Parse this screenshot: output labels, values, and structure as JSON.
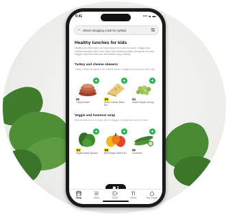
{
  "status": {
    "time": "9:41",
    "signal": "••• ▴ ▬"
  },
  "search": {
    "text": "What's shopping crush for mylistid"
  },
  "page": {
    "title": "Healthy lunches for kids",
    "description": "Healthy lunches make our kids enjoy not to eat the same. Veggie and cheese skewers offer a fun, fresh and nutritious option alongside an easy veggie wrap that kids love and adults enjoy making."
  },
  "sections": [
    {
      "title": "Turkey and cheese skewers",
      "subtitle": "Turkey cutlets are served with cheese pieces, veggies and crackers with a dip.",
      "products": [
        {
          "price": "$6",
          "name": "Turkey Breast",
          "sale": false,
          "image": "turkey-slices"
        },
        {
          "price": "$6",
          "name": "Swiss Cheese Slices 8oz",
          "sale": true,
          "image": "cheese-block"
        },
        {
          "price": "$4",
          "name": "Sweet Grapes 1lb bag",
          "sale": false,
          "image": "green-grapes"
        }
      ]
    },
    {
      "title": "Veggie and hummus wrap",
      "subtitle": "Spread hummus on a wrap, pile on veggies, roll tight and slice for lunch.",
      "products": [
        {
          "price": "$2",
          "name": "Organic Baby Spinach",
          "sale": true,
          "image": "spinach"
        },
        {
          "price": "$5",
          "name": "Bell Peppers Mixed 3ct",
          "sale": true,
          "image": "bell-peppers"
        },
        {
          "price": "$5",
          "name": "Cucumber",
          "sale": false,
          "image": "cucumber"
        }
      ]
    }
  ],
  "cart": {
    "count": "3"
  },
  "tabs": [
    {
      "label": "Shop",
      "icon": "store-icon",
      "active": true
    },
    {
      "label": "Aisles",
      "icon": "list-icon",
      "active": false
    },
    {
      "label": "Deals",
      "icon": "tag-icon",
      "active": false
    },
    {
      "label": "Meals",
      "icon": "fork-knife-icon",
      "active": false
    },
    {
      "label": "Buy it again",
      "icon": "apple-icon",
      "active": false
    }
  ],
  "colors": {
    "accent": "#1db44a",
    "sale": "#ffe600"
  }
}
